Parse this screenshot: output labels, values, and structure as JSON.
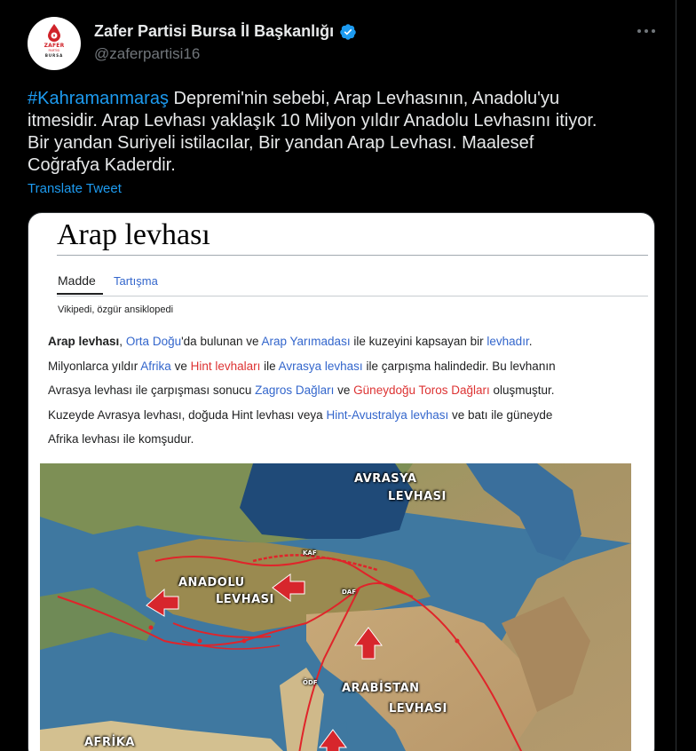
{
  "account": {
    "display_name": "Zafer Partisi Bursa İl Başkanlığı",
    "handle": "@zaferpartisi16",
    "avatar_top": "ZAFER",
    "avatar_mid": "PARTİSİ",
    "avatar_bottom": "BURSA",
    "verified_icon": "verified-badge-icon"
  },
  "tweet": {
    "hashtag": "#Kahramanmaraş",
    "line1_rest": " Depremi'nin sebebi, Arap Levhasının, Anadolu'yu",
    "line2": "itmesidir. Arap Levhası yaklaşık 10 Milyon yıldır Anadolu Levhasını itiyor.",
    "line3": "Bir yandan Suriyeli istilacılar, Bir yandan Arap Levhası. Maalesef",
    "line4": "Coğrafya Kaderdir.",
    "translate_label": "Translate Tweet"
  },
  "media": {
    "title": "Arap levhası",
    "tab_article": "Madde",
    "tab_talk": "Tartışma",
    "tagline": "Vikipedi, özgür ansiklopedi",
    "p": {
      "t1": "Arap levhası",
      "t2": ", ",
      "t3": "Orta Doğu",
      "t4": "'da bulunan ve ",
      "t5": "Arap Yarımadası",
      "t6": " ile kuzeyini kapsayan bir ",
      "t7": "levhadır",
      "t8": ".",
      "t9": "Milyonlarca yıldır ",
      "t10": "Afrika",
      "t11": " ve ",
      "t12": "Hint levhaları",
      "t13": " ile ",
      "t14": "Avrasya levhası",
      "t15": " ile çarpışma halindedir. Bu levhanın",
      "t16": "Avrasya levhası ile çarpışması sonucu ",
      "t17": "Zagros Dağları",
      "t18": " ve ",
      "t19": "Güneydoğu Toros Dağları",
      "t20": " oluşmuştur.",
      "t21": "Kuzeyde Avrasya levhası, doğuda Hint levhası veya ",
      "t22": "Hint-Avustralya levhası",
      "t23": " ve batı ile güneyde",
      "t24": "Afrika levhası ile komşudur."
    },
    "map_labels": {
      "avrasya": "AVRASYA",
      "avrasya2": "LEVHASI",
      "anadolu": "ANADOLU",
      "anadolu2": "LEVHASI",
      "arabistan": "ARABİSTAN",
      "arabistan2": "LEVHASI",
      "afrika": "AFRİKA",
      "kaf": "KAF",
      "daf": "DAF",
      "ldf": "ÖDF"
    }
  }
}
